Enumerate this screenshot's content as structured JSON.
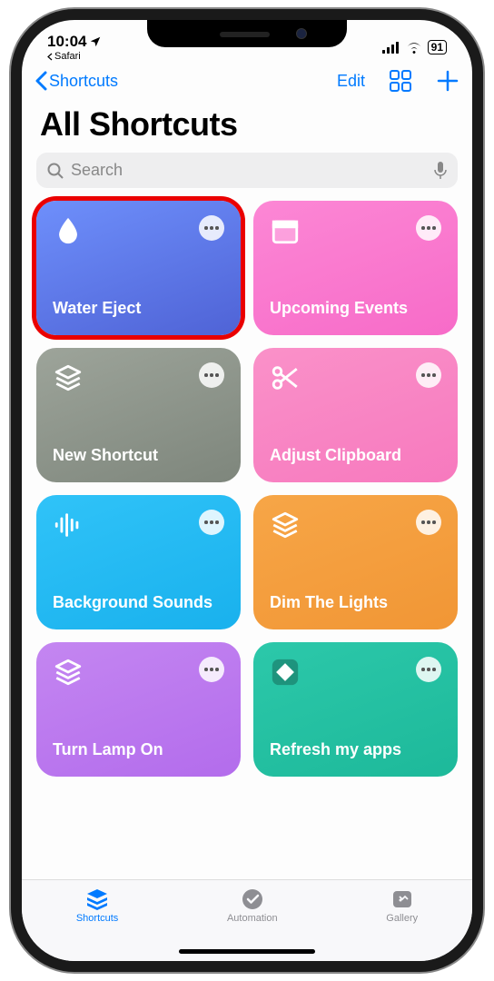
{
  "status": {
    "time": "10:04",
    "back_app": "Safari",
    "battery": "91"
  },
  "nav": {
    "back_label": "Shortcuts",
    "edit_label": "Edit"
  },
  "page": {
    "title": "All Shortcuts"
  },
  "search": {
    "placeholder": "Search"
  },
  "tiles": [
    {
      "label": "Water Eject",
      "icon": "droplet",
      "colorClass": "c-blue",
      "highlighted": true
    },
    {
      "label": "Upcoming Events",
      "icon": "calendar",
      "colorClass": "c-pink",
      "highlighted": false
    },
    {
      "label": "New Shortcut",
      "icon": "layers",
      "colorClass": "c-gray",
      "highlighted": false
    },
    {
      "label": "Adjust Clipboard",
      "icon": "scissors",
      "colorClass": "c-pink2",
      "highlighted": false
    },
    {
      "label": "Background Sounds",
      "icon": "waveform",
      "colorClass": "c-sky",
      "highlighted": false
    },
    {
      "label": "Dim The Lights",
      "icon": "layers",
      "colorClass": "c-orange",
      "highlighted": false
    },
    {
      "label": "Turn Lamp On",
      "icon": "layers",
      "colorClass": "c-purple",
      "highlighted": false
    },
    {
      "label": "Refresh my apps",
      "icon": "diamond",
      "colorClass": "c-teal",
      "highlighted": false
    }
  ],
  "tabs": {
    "shortcuts": "Shortcuts",
    "automation": "Automation",
    "gallery": "Gallery"
  }
}
